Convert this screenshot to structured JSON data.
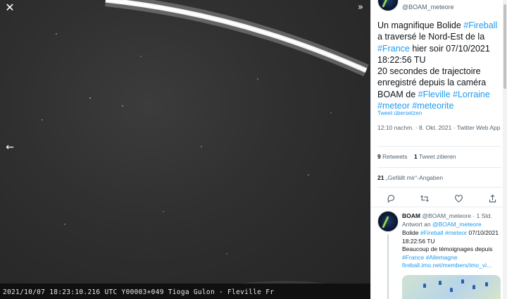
{
  "viewer": {
    "caption": "2021/10/07 18:23:10.216 UTC Y00003+049 Tioga Gulon - Fleville Fr",
    "close_icon": "close-icon",
    "back_icon": "arrow-left-icon",
    "expand_icon": "expand-icon",
    "colors": {
      "background": "#2d2d2d",
      "fireball": "#ffffff",
      "caption_strip": "#101010"
    }
  },
  "tweet": {
    "handle": "@BOAM_meteore",
    "text": {
      "p1": "Un magnifique Bolide ",
      "tag_fireball": "#Fireball",
      "p2": " a traversé le Nord-Est de la ",
      "tag_france": "#France",
      "p3": " hier soir 07/10/2021 18:22:56 TU",
      "p4": "20 secondes de trajectoire enregistré depuis la caméra BOAM de ",
      "tag_fleville": "#Fleville",
      "tag_lorraine": "#Lorraine",
      "tag_meteor": "#meteor",
      "tag_meteorite": "#meteorite"
    },
    "translate": "Tweet übersetzen",
    "meta": "12:10 nachm. · 8. Okt. 2021 · Twitter Web App",
    "retweets_count": "9",
    "retweets_label": "Retweets",
    "quotes_count": "1",
    "quotes_label": "Tweet zitieren",
    "likes_count": "21",
    "likes_label": "„Gefällt mir“-Angaben",
    "actions": [
      "reply-icon",
      "retweet-icon",
      "like-icon",
      "share-icon"
    ]
  },
  "reply": {
    "name": "BOAM",
    "handle_time": "@BOAM_meteore · 1 Std.",
    "reply_prefix": "Antwort an ",
    "reply_to": "@BOAM_meteore",
    "t1": "Bolide ",
    "tag_fireball": "#Fireball",
    "tag_meteor": "#meteor",
    "t2": " 07/10/2021 18:22:56 TU",
    "t3": "Beaucoup de témoignages depuis ",
    "tag_france": "#France",
    "tag_allemagne": "#Allemagne",
    "link": "fireball.imo.net/members/imo_vi..."
  },
  "accent_color": "#1d9bf0"
}
